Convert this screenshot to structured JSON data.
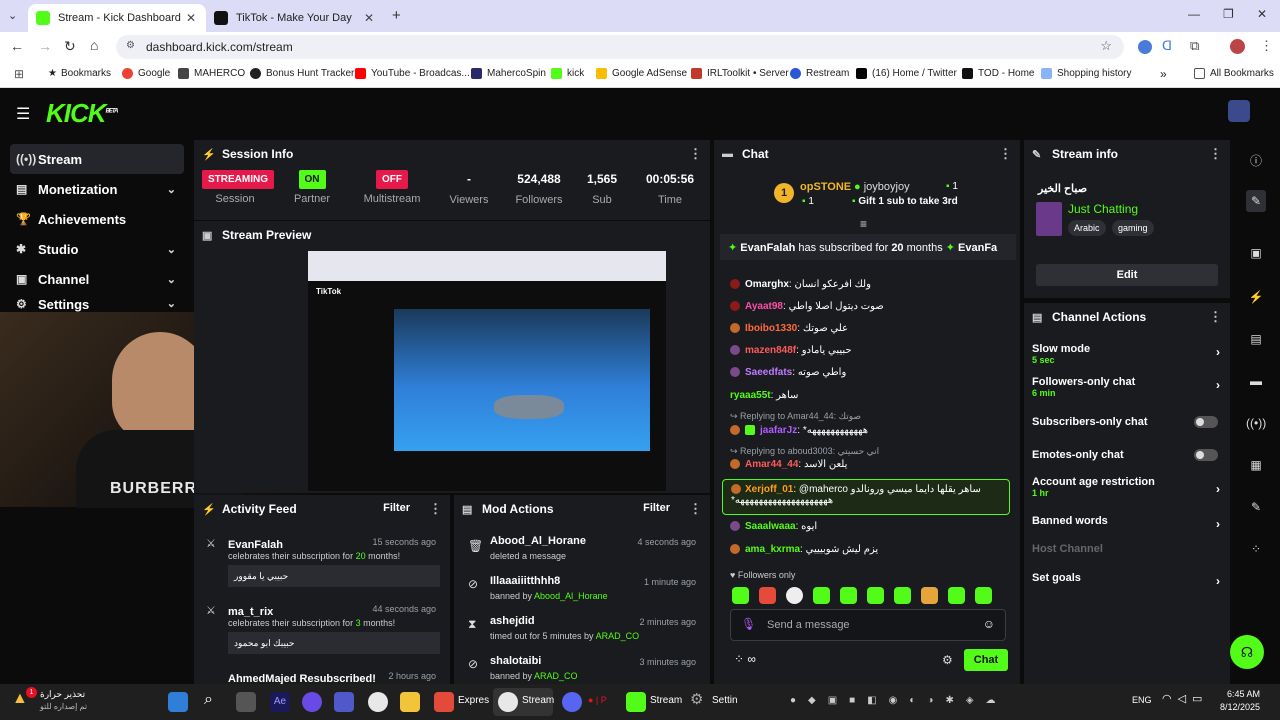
{
  "browser": {
    "tabs": [
      {
        "label": "Stream - Kick Dashboard"
      },
      {
        "label": "TikTok - Make Your Day"
      }
    ],
    "url": "dashboard.kick.com/stream",
    "bookmarks": [
      "Bookmarks",
      "Google",
      "MAHERCO",
      "Bonus Hunt Tracker",
      "YouTube - Broadcas...",
      "MahercoSpin",
      "kick",
      "Google AdSense",
      "IRLToolkit • Server",
      "Restream",
      "(16) Home / Twitter",
      "TOD - Home",
      "Shopping history"
    ],
    "all_bookmarks": "All Bookmarks"
  },
  "sidebar": {
    "items": [
      {
        "label": "Stream"
      },
      {
        "label": "Monetization"
      },
      {
        "label": "Achievements"
      },
      {
        "label": "Studio"
      },
      {
        "label": "Channel"
      },
      {
        "label": "Settings"
      }
    ]
  },
  "session": {
    "title": "Session Info",
    "stats": [
      {
        "value": "STREAMING",
        "label": "Session"
      },
      {
        "value": "ON",
        "label": "Partner"
      },
      {
        "value": "OFF",
        "label": "Multistream"
      },
      {
        "value": "-",
        "label": "Viewers"
      },
      {
        "value": "524,488",
        "label": "Followers"
      },
      {
        "value": "1,565",
        "label": "Sub"
      },
      {
        "value": "00:05:56",
        "label": "Time"
      }
    ]
  },
  "preview": {
    "title": "Stream Preview",
    "tiktok": "TikTok"
  },
  "activity": {
    "title": "Activity Feed",
    "filter": "Filter",
    "items": [
      {
        "user": "EvanFalah",
        "time": "15 seconds ago",
        "pre": "celebrates their subscription for ",
        "num": "20",
        "post": " months!",
        "msg": "حبيبي يا مقوور"
      },
      {
        "user": "ma_t_rix",
        "time": "44 seconds ago",
        "pre": "celebrates their subscription for ",
        "num": "3",
        "post": " months!",
        "msg": "حبيبك ابو محمود"
      },
      {
        "user": "AhmedMajed Resubscribed!",
        "time": "2 hours ago"
      }
    ]
  },
  "mod": {
    "title": "Mod Actions",
    "filter": "Filter",
    "items": [
      {
        "user": "Abood_Al_Horane",
        "time": "4 seconds ago",
        "pre": "deleted a message",
        "by": ""
      },
      {
        "user": "Illaaaiiitthhh8",
        "time": "1 minute ago",
        "pre": "banned by ",
        "by": "Abood_Al_Horane"
      },
      {
        "user": "ashejdid",
        "time": "2 minutes ago",
        "pre": "timed out for 5 minutes by ",
        "by": "ARAD_CO"
      },
      {
        "user": "shalotaibi",
        "time": "3 minutes ago",
        "pre": "banned by ",
        "by": "ARAD_CO"
      }
    ]
  },
  "chat": {
    "title": "Chat",
    "top": {
      "rank": "1",
      "user": "opSTONE",
      "count": "1",
      "user2": "joyboyjoy",
      "count2": "1",
      "gift": "Gift 1 sub to take 3rd"
    },
    "sub_banner": {
      "user": "EvanFalah",
      "pre": " has subscribed for ",
      "num": "20",
      "post": " months",
      "tail": "EvanFa"
    },
    "messages": [
      {
        "user": "Omarghx",
        "color": "#ff4da6",
        "text": "ولك افرعكو انسان"
      },
      {
        "user": "Ayaat98",
        "color": "#ff4da6",
        "text": "صوت ديتول اصلا واطي"
      },
      {
        "user": "Iboibo1330",
        "color": "#ff6a3d",
        "text": "علي صوتك"
      },
      {
        "user": "mazen848f",
        "color": "#ff5a5a",
        "text": "حبيبي يامادو"
      },
      {
        "user": "Saeedfats",
        "color": "#c07cff",
        "text": "واطي صوته"
      },
      {
        "user": "ryaaa55t",
        "color": "#53fc18",
        "text": "ساهر"
      },
      {
        "reply": "Replying to Amar44_44: صوتك",
        "user": "jaafarJz",
        "color": "#b05cff",
        "text": "*ههههههههههههه"
      },
      {
        "reply": "Replying to aboud3003: اني حسيتي",
        "user": "Amar44_44",
        "color": "#ff5a5a",
        "text": "يلعن الاسد"
      },
      {
        "user": "Xerjoff_01",
        "color": "#ff9f1c",
        "text": "@maherco ساهر يقلها دايما ميسي ورونالدو",
        "text2": "*ههههههههههههههههههههه",
        "highlight": true
      },
      {
        "user": "Saaalwaaa",
        "color": "#53fc18",
        "text": "ايوه"
      },
      {
        "user": "ama_kxrma",
        "color": "#53fc18",
        "text": "يزم ليش شوبيييي"
      }
    ],
    "followers_only": "Followers only",
    "placeholder": "Send a message",
    "send": "Chat"
  },
  "stream_info": {
    "title": "Stream info",
    "stream_title": "صباح الخير",
    "category": "Just Chatting",
    "tags": [
      "Arabic",
      "gaming"
    ],
    "edit": "Edit"
  },
  "channel_actions": {
    "title": "Channel Actions",
    "items": [
      {
        "label": "Slow mode",
        "value": "5 sec",
        "type": "chev"
      },
      {
        "label": "Followers-only chat",
        "value": "6 min",
        "type": "chev"
      },
      {
        "label": "Subscribers-only chat",
        "value": "",
        "type": "toggle"
      },
      {
        "label": "Emotes-only chat",
        "value": "",
        "type": "toggle"
      },
      {
        "label": "Account age restriction",
        "value": "1 hr",
        "type": "chev"
      },
      {
        "label": "Banned words",
        "value": "",
        "type": "chev"
      },
      {
        "label": "Host Channel",
        "value": "",
        "type": "disabled"
      },
      {
        "label": "Set goals",
        "value": "",
        "type": "chev"
      }
    ]
  },
  "taskbar": {
    "weather": "تحذير حرارة",
    "weather2": "تم إصداره للتو",
    "badge": "1",
    "apps": [
      "Expres",
      "Stream",
      "Stream",
      "Settin"
    ],
    "lang": "ENG",
    "time": "6:45 AM",
    "date": "8/12/2025"
  },
  "colors": {
    "kick_green": "#53fc18",
    "panel": "#191b1f",
    "streaming_red": "#e5194a"
  }
}
